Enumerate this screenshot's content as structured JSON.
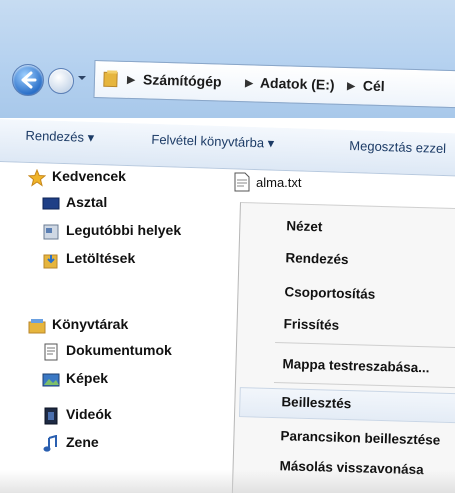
{
  "address": {
    "crumbs": [
      "Számítógép",
      "Adatok (E:)",
      "Cél"
    ]
  },
  "toolbar": {
    "organize": "Rendezés",
    "include_library": "Felvétel könyvtárba",
    "share": "Megosztás ezzel"
  },
  "sidebar": {
    "favorites": "Kedvencek",
    "desktop": "Asztal",
    "recent": "Legutóbbi helyek",
    "downloads": "Letöltések",
    "libraries": "Könyvtárak",
    "documents": "Dokumentumok",
    "pictures": "Képek",
    "videos": "Videók",
    "music": "Zene"
  },
  "file": {
    "name": "alma.txt"
  },
  "context_menu": {
    "view": "Nézet",
    "sort": "Rendezés",
    "group": "Csoportosítás",
    "refresh": "Frissítés",
    "customize": "Mappa testreszabása...",
    "paste": "Beillesztés",
    "paste_shortcut": "Parancsikon beillesztése",
    "undo_copy": "Másolás visszavonása"
  },
  "colors": {
    "accent": "#2a6fc8",
    "toolbar_text": "#1c3b66"
  }
}
